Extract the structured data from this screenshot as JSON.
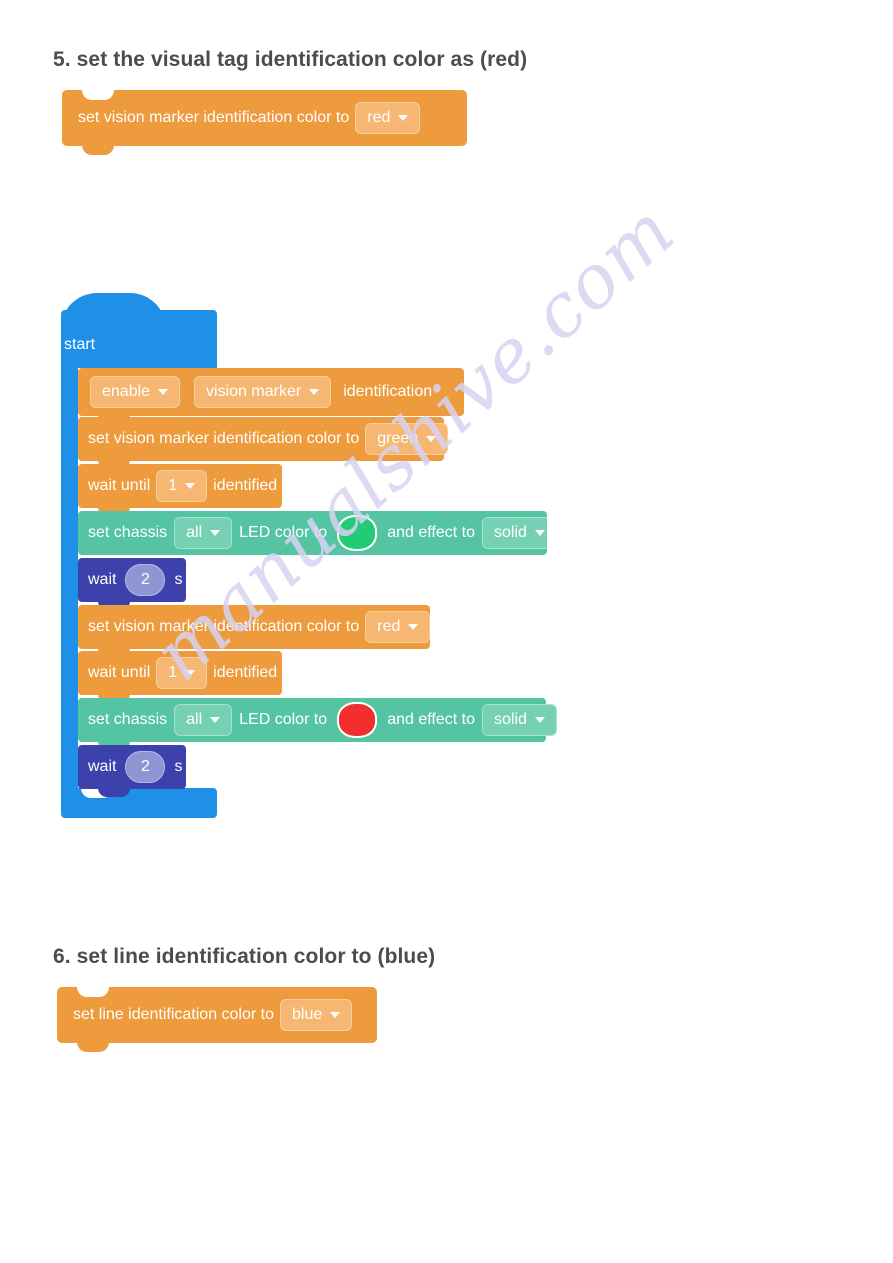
{
  "page": {
    "watermark": "manualshive.com",
    "watermark_color": "#d7d3f2",
    "background": "#ffffff",
    "heading_color": "#4c4c4c"
  },
  "palette": {
    "orange": "#ee9b3e",
    "orange_light": "#f6b772",
    "teal": "#55c4a3",
    "teal_light": "#76d0b4",
    "indigo": "#3c41ab",
    "indigo_light": "#8f94d2",
    "blue": "#1e90e8",
    "led_green": "#22cc77",
    "led_red": "#f12f2f"
  },
  "sections": {
    "five": {
      "heading": "5. set the visual tag identification color as (red)",
      "block": {
        "label": "set vision marker identification color to",
        "dropdown_value": "red",
        "dropdown_icon": "chevron-down-icon"
      }
    },
    "six": {
      "heading": "6. set line identification color to (blue)",
      "block": {
        "label": "set line identification color to",
        "dropdown_value": "blue",
        "dropdown_icon": "chevron-down-icon"
      }
    }
  },
  "program": {
    "hat_label": "start",
    "rows": [
      {
        "kind": "orange",
        "type": "enable-identification",
        "prefix": "",
        "dropdown_1": "enable",
        "dropdown_2": "vision marker",
        "suffix": "identification"
      },
      {
        "kind": "orange",
        "type": "set-vision-marker-color",
        "prefix": "set vision marker identification color to",
        "dropdown_1": "green",
        "suffix": ""
      },
      {
        "kind": "orange",
        "type": "wait-until-identified",
        "prefix": "wait until",
        "dropdown_1": "1",
        "suffix": "identified"
      },
      {
        "kind": "teal",
        "type": "set-chassis-led",
        "prefix": "set chassis",
        "dropdown_1": "all",
        "mid": "LED color to",
        "led_color": "#22cc77",
        "mid2": "and effect to",
        "dropdown_2": "solid"
      },
      {
        "kind": "indigo",
        "type": "wait-seconds",
        "prefix": "wait",
        "value": "2",
        "suffix": "s"
      },
      {
        "kind": "orange",
        "type": "set-vision-marker-color",
        "prefix": "set vision marker identification color to",
        "dropdown_1": "red",
        "suffix": ""
      },
      {
        "kind": "orange",
        "type": "wait-until-identified",
        "prefix": "wait until",
        "dropdown_1": "1",
        "suffix": "identified"
      },
      {
        "kind": "teal",
        "type": "set-chassis-led",
        "prefix": "set chassis",
        "dropdown_1": "all",
        "mid": "LED color to",
        "led_color": "#f12f2f",
        "mid2": "and effect to",
        "dropdown_2": "solid"
      },
      {
        "kind": "indigo",
        "type": "wait-seconds",
        "prefix": "wait",
        "value": "2",
        "suffix": "s"
      }
    ]
  }
}
